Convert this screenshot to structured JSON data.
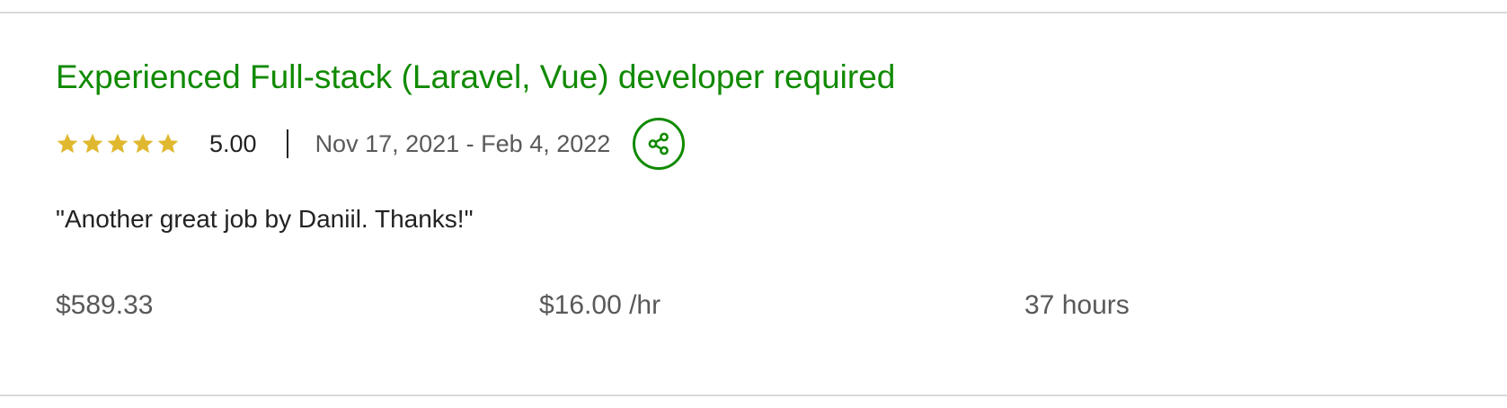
{
  "job": {
    "title": "Experienced Full-stack (Laravel, Vue) developer required",
    "rating": {
      "stars": 5,
      "max_stars": 5,
      "value": "5.00",
      "star_icon": "star-icon",
      "star_color": "#e0b82f"
    },
    "date_range": "Nov 17, 2021 - Feb 4, 2022",
    "share_icon": "share-icon",
    "feedback": "\"Another great job by Daniil. Thanks!\"",
    "stats": {
      "earned": "$589.33",
      "rate": "$16.00 /hr",
      "hours": "37 hours"
    }
  },
  "colors": {
    "accent": "#108a00",
    "text": "#222222",
    "muted": "#595959",
    "divider": "#d9d9d9"
  }
}
